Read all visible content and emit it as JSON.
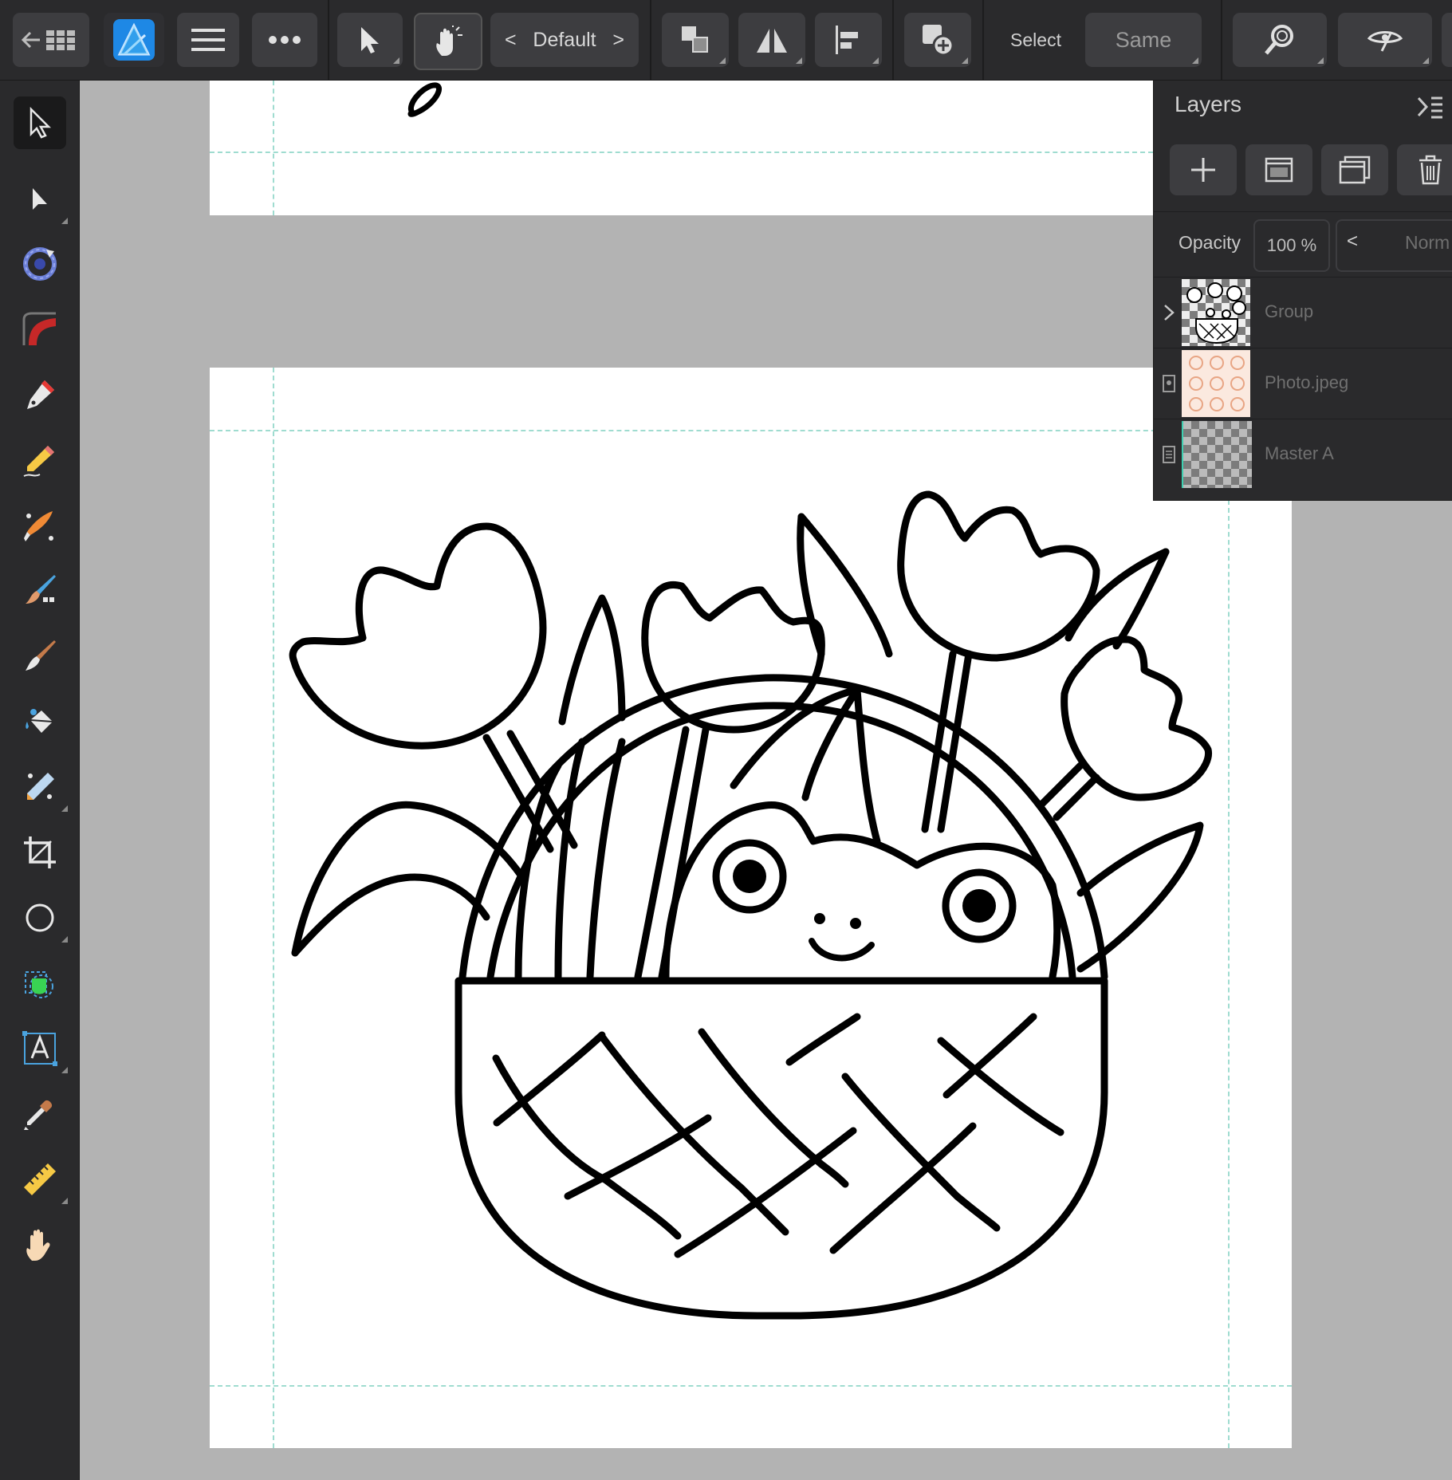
{
  "topbar": {
    "preset": {
      "prev": "<",
      "label": "Default",
      "next": ">"
    },
    "select_label": "Select",
    "same_label": "Same"
  },
  "layers_panel": {
    "title": "Layers",
    "opacity_label": "Opacity",
    "opacity_value": "100 %",
    "blend_prev": "<",
    "blend_mode": "Norm",
    "layers": [
      {
        "name": "Group",
        "type": "group",
        "expanded": false
      },
      {
        "name": "Photo.jpeg",
        "type": "image"
      },
      {
        "name": "Master A",
        "type": "master"
      }
    ]
  },
  "colors": {
    "ui_dark": "#2a2a2c",
    "button": "#3d3d40",
    "canvas": "#b3b3b3",
    "guide": "#9fdcd0",
    "app_icon": "#1e88e5"
  },
  "tools": [
    "move-tool-icon",
    "node-tool-icon",
    "color-picker-wheel-icon",
    "gradient-tool-icon",
    "pen-tool-icon",
    "pencil-tool-icon",
    "vector-brush-icon",
    "pixel-brush-icon",
    "paint-brush-icon",
    "fill-tool-icon",
    "transparency-tool-icon",
    "crop-tool-icon",
    "ellipse-tool-icon",
    "shape-builder-icon",
    "artistic-text-icon",
    "eyedropper-icon",
    "measure-tool-icon",
    "hand-tool-icon"
  ]
}
